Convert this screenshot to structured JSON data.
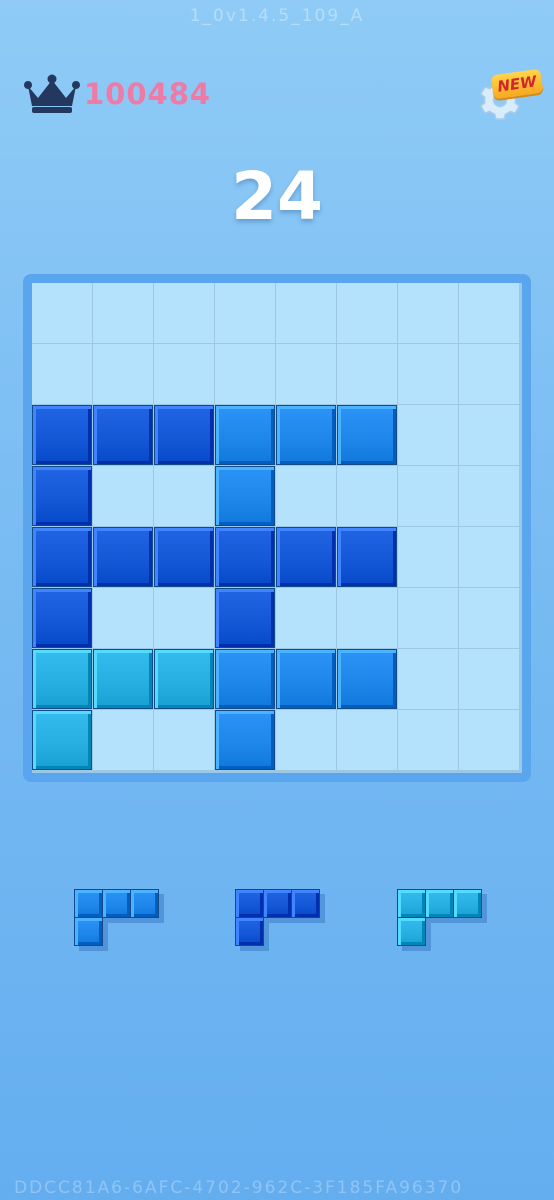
{
  "version_label": "1_0v1.4.5_109_A",
  "best": {
    "icon": "crown-icon",
    "value": "100484",
    "color": "#f07aa6"
  },
  "settings": {
    "icon": "gear-icon",
    "badge": "NEW"
  },
  "score": "24",
  "board": {
    "rows": 8,
    "cols": 8,
    "empty_color": "#b4e2fd",
    "palette": {
      "1": "#1457d6",
      "2": "#1e86e8",
      "3": "#27aee0"
    },
    "cells": [
      [
        0,
        0,
        0,
        0,
        0,
        0,
        0,
        0
      ],
      [
        0,
        0,
        0,
        0,
        0,
        0,
        0,
        0
      ],
      [
        1,
        1,
        1,
        2,
        2,
        2,
        0,
        0
      ],
      [
        1,
        0,
        0,
        2,
        0,
        0,
        0,
        0
      ],
      [
        1,
        1,
        1,
        1,
        1,
        1,
        0,
        0
      ],
      [
        1,
        0,
        0,
        1,
        0,
        0,
        0,
        0
      ],
      [
        3,
        3,
        3,
        2,
        2,
        2,
        0,
        0
      ],
      [
        3,
        0,
        0,
        2,
        0,
        0,
        0,
        0
      ]
    ]
  },
  "pieces": [
    {
      "name": "piece-1",
      "color": "#1e86e8",
      "shape": [
        [
          1,
          1,
          1
        ],
        [
          1,
          0,
          0
        ]
      ]
    },
    {
      "name": "piece-2",
      "color": "#1457d6",
      "shape": [
        [
          1,
          1,
          1
        ],
        [
          1,
          0,
          0
        ]
      ]
    },
    {
      "name": "piece-3",
      "color": "#27aee0",
      "shape": [
        [
          1,
          1,
          1
        ],
        [
          1,
          0,
          0
        ]
      ]
    }
  ],
  "device_id": "DDCC81A6-6AFC-4702-962C-3F185FA96370"
}
